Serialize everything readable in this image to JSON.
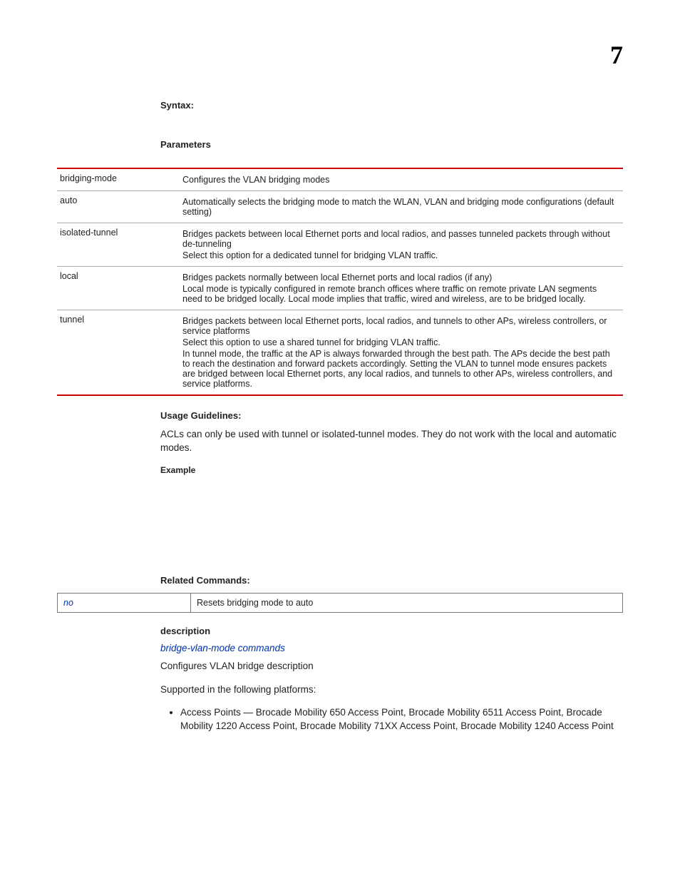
{
  "page_number": "7",
  "labels": {
    "syntax": "Syntax:",
    "parameters": "Parameters",
    "usage_guidelines": "Usage Guidelines:",
    "example": "Example",
    "related_commands": "Related Commands:",
    "description": "description"
  },
  "params_table": [
    {
      "name": "bridging-mode",
      "desc": [
        "Configures the VLAN bridging modes"
      ]
    },
    {
      "name": "auto",
      "desc": [
        "Automatically selects the bridging mode to match the WLAN, VLAN and bridging mode configurations (default setting)"
      ]
    },
    {
      "name": "isolated-tunnel",
      "desc": [
        "Bridges packets between local Ethernet ports and local radios, and passes tunneled packets through without de-tunneling",
        "Select this option for a dedicated tunnel for bridging VLAN traffic."
      ]
    },
    {
      "name": "local",
      "desc": [
        "Bridges packets normally between local Ethernet ports and local radios (if any)",
        "Local mode is typically configured in remote branch offices where traffic on remote private LAN segments need to be bridged locally. Local mode implies that traffic, wired and wireless, are to be bridged locally."
      ]
    },
    {
      "name": "tunnel",
      "desc": [
        "Bridges packets between local Ethernet ports, local radios, and tunnels to other APs, wireless controllers, or service platforms",
        "Select this option to use a shared tunnel for bridging VLAN traffic.",
        "In tunnel mode, the traffic at the AP is always forwarded through the best path. The APs decide the best path to reach the destination and forward packets accordingly. Setting the VLAN to tunnel mode ensures packets are bridged between local Ethernet ports, any local radios, and tunnels to other APs, wireless controllers, and service platforms."
      ]
    }
  ],
  "usage_text": "ACLs can only be used with tunnel or isolated-tunnel modes. They do not work with the local and automatic modes.",
  "related_table": [
    {
      "cmd": "no",
      "desc": "Resets bridging mode to auto"
    }
  ],
  "description_section": {
    "link_text": "bridge-vlan-mode commands",
    "line1": "Configures VLAN bridge description",
    "line2": "Supported in the following platforms:",
    "bullet": "Access Points — Brocade Mobility 650 Access Point, Brocade Mobility 6511 Access Point, Brocade Mobility 1220 Access Point, Brocade Mobility 71XX Access Point, Brocade Mobility 1240 Access Point"
  }
}
